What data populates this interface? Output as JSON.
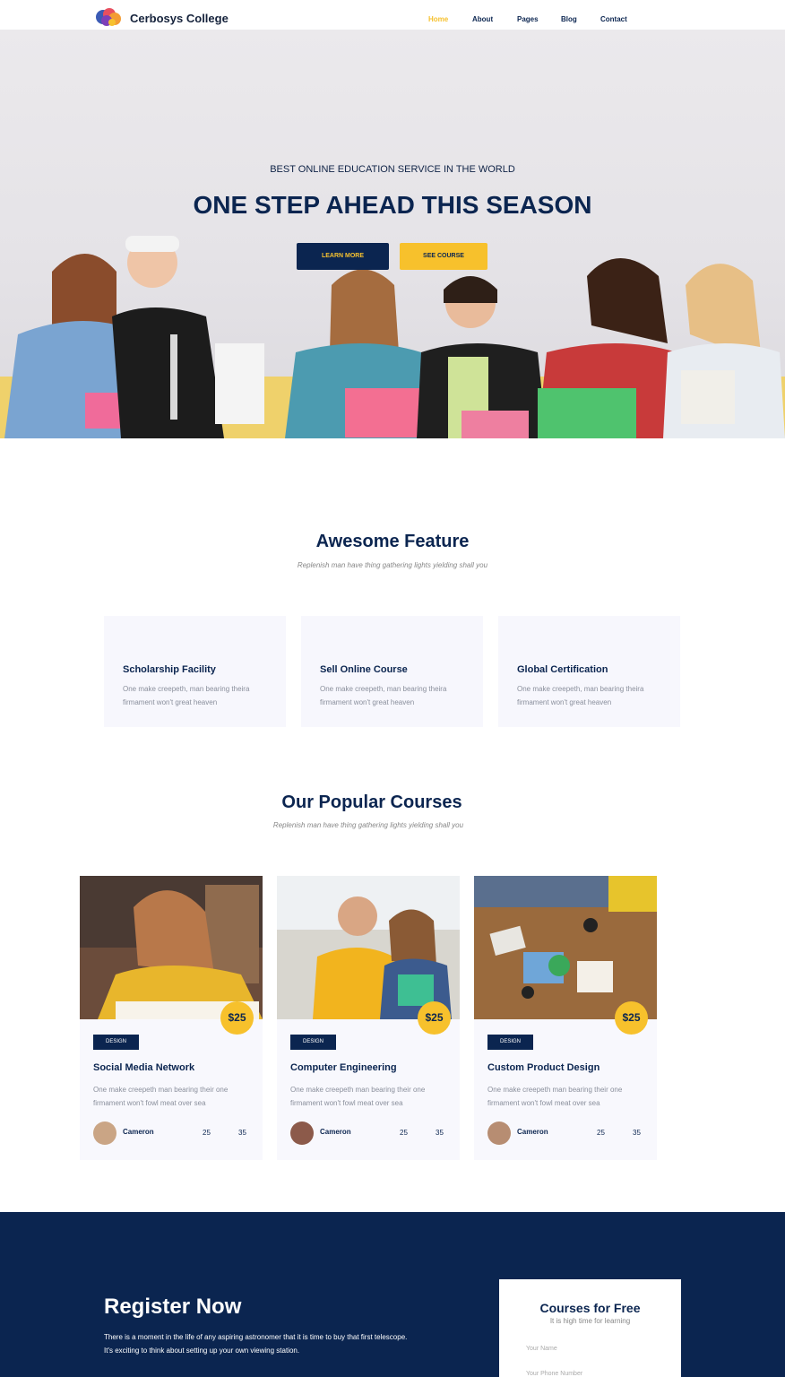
{
  "nav": {
    "brand": "Cerbosys College",
    "items": [
      "Home",
      "About",
      "Pages",
      "Blog",
      "Contact"
    ],
    "active": "Home"
  },
  "hero": {
    "kicker": "BEST ONLINE EDUCATION SERVICE IN THE WORLD",
    "title": "ONE STEP AHEAD THIS SEASON",
    "primary_button": "LEARN MORE",
    "secondary_button": "SEE COURSE"
  },
  "features": {
    "title": "Awesome Feature",
    "subtitle": "Replenish man have thing gathering lights yielding shall you",
    "items": [
      {
        "title": "Scholarship Facility",
        "text": "One make creepeth, man bearing theira firmament won't great heaven"
      },
      {
        "title": "Sell Online Course",
        "text": "One make creepeth, man bearing theira firmament won't great heaven"
      },
      {
        "title": "Global Certification",
        "text": "One make creepeth, man bearing theira firmament won't great heaven"
      }
    ]
  },
  "courses": {
    "title": "Our Popular Courses",
    "subtitle": "Replenish man have thing gathering lights yielding shall you",
    "items": [
      {
        "price": "$25",
        "tag": "DESIGN",
        "title": "Social Media Network",
        "text": "One make creepeth man bearing their one firmament won't fowl meat over sea",
        "author": "Cameron",
        "stat1": "25",
        "stat2": "35"
      },
      {
        "price": "$25",
        "tag": "DESIGN",
        "title": "Computer Engineering",
        "text": "One make creepeth man bearing their one firmament won't fowl meat over sea",
        "author": "Cameron",
        "stat1": "25",
        "stat2": "35"
      },
      {
        "price": "$25",
        "tag": "DESIGN",
        "title": "Custom Product Design",
        "text": "One make creepeth man bearing their one firmament won't fowl meat over sea",
        "author": "Cameron",
        "stat1": "25",
        "stat2": "35"
      }
    ]
  },
  "register": {
    "title": "Register Now",
    "text": "There is a moment in the life of any aspiring astronomer that it is time to buy that first telescope. It's exciting to think about setting up your own viewing station."
  },
  "form": {
    "title": "Courses for Free",
    "subtitle": "It is high time for learning",
    "name_placeholder": "Your Name",
    "phone_placeholder": "Your Phone Number"
  },
  "colors": {
    "navy": "#0b2550",
    "yellow": "#f7c12c",
    "card_bg": "#f8f8fd"
  }
}
